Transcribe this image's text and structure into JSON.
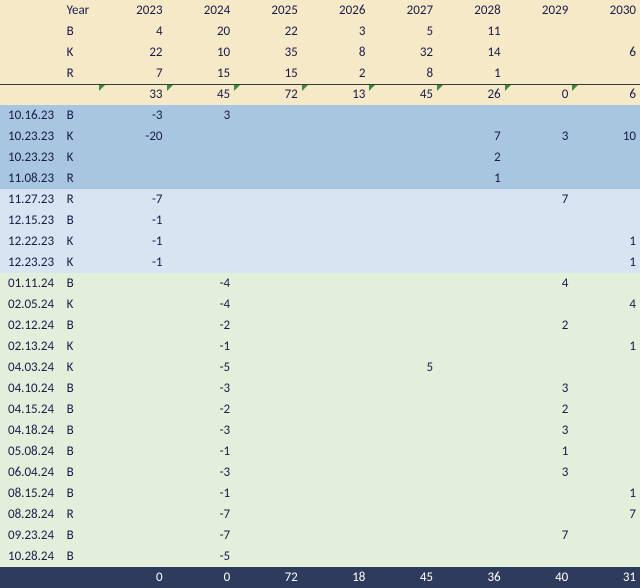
{
  "header": {
    "year_label": "Year",
    "years": [
      "2023",
      "2024",
      "2025",
      "2026",
      "2027",
      "2028",
      "2029",
      "2030"
    ],
    "series": [
      {
        "label": "B",
        "v": [
          "4",
          "20",
          "22",
          "3",
          "5",
          "11",
          "",
          ""
        ]
      },
      {
        "label": "K",
        "v": [
          "22",
          "10",
          "35",
          "8",
          "32",
          "14",
          "",
          "6"
        ]
      },
      {
        "label": "R",
        "v": [
          "7",
          "15",
          "15",
          "2",
          "8",
          "1",
          "",
          ""
        ]
      }
    ],
    "totals": [
      "33",
      "45",
      "72",
      "13",
      "45",
      "26",
      "0",
      "6"
    ]
  },
  "rows": [
    {
      "band": "blue1",
      "date": "10.16.23",
      "k": "B",
      "v": [
        "-3",
        "3",
        "",
        "",
        "",
        "",
        "",
        ""
      ]
    },
    {
      "band": "blue1",
      "date": "10.23.23",
      "k": "K",
      "v": [
        "-20",
        "",
        "",
        "",
        "",
        "7",
        "3",
        "10"
      ]
    },
    {
      "band": "blue1",
      "date": "10.23.23",
      "k": "K",
      "v": [
        "",
        "",
        "",
        "",
        "",
        "2",
        "",
        ""
      ]
    },
    {
      "band": "blue1",
      "date": "11.08.23",
      "k": "R",
      "v": [
        "",
        "",
        "",
        "",
        "",
        "1",
        "",
        ""
      ]
    },
    {
      "band": "blue2",
      "date": "11.27.23",
      "k": "R",
      "v": [
        "-7",
        "",
        "",
        "",
        "",
        "",
        "7",
        ""
      ]
    },
    {
      "band": "blue2",
      "date": "12.15.23",
      "k": "B",
      "v": [
        "-1",
        "",
        "",
        "",
        "",
        "",
        "",
        ""
      ]
    },
    {
      "band": "blue2",
      "date": "12.22.23",
      "k": "K",
      "v": [
        "-1",
        "",
        "",
        "",
        "",
        "",
        "",
        "1"
      ]
    },
    {
      "band": "blue2",
      "date": "12.23.23",
      "k": "K",
      "v": [
        "-1",
        "",
        "",
        "",
        "",
        "",
        "",
        "1"
      ]
    },
    {
      "band": "green",
      "date": "01.11.24",
      "k": "B",
      "v": [
        "",
        "-4",
        "",
        "",
        "",
        "",
        "4",
        ""
      ]
    },
    {
      "band": "green",
      "date": "02.05.24",
      "k": "K",
      "v": [
        "",
        "-4",
        "",
        "",
        "",
        "",
        "",
        "4"
      ]
    },
    {
      "band": "green",
      "date": "02.12.24",
      "k": "B",
      "v": [
        "",
        "-2",
        "",
        "",
        "",
        "",
        "2",
        ""
      ]
    },
    {
      "band": "green",
      "date": "02.13.24",
      "k": "K",
      "v": [
        "",
        "-1",
        "",
        "",
        "",
        "",
        "",
        "1"
      ]
    },
    {
      "band": "green",
      "date": "04.03.24",
      "k": "K",
      "v": [
        "",
        "-5",
        "",
        "",
        "5",
        "",
        "",
        ""
      ]
    },
    {
      "band": "green",
      "date": "04.10.24",
      "k": "B",
      "v": [
        "",
        "-3",
        "",
        "",
        "",
        "",
        "3",
        ""
      ]
    },
    {
      "band": "green",
      "date": "04.15.24",
      "k": "B",
      "v": [
        "",
        "-2",
        "",
        "",
        "",
        "",
        "2",
        ""
      ]
    },
    {
      "band": "green",
      "date": "04.18.24",
      "k": "B",
      "v": [
        "",
        "-3",
        "",
        "",
        "",
        "",
        "3",
        ""
      ]
    },
    {
      "band": "green",
      "date": "05.08.24",
      "k": "B",
      "v": [
        "",
        "-1",
        "",
        "",
        "",
        "",
        "1",
        ""
      ]
    },
    {
      "band": "green",
      "date": "06.04.24",
      "k": "B",
      "v": [
        "",
        "-3",
        "",
        "",
        "",
        "",
        "3",
        ""
      ]
    },
    {
      "band": "green",
      "date": "08.15.24",
      "k": "B",
      "v": [
        "",
        "-1",
        "",
        "",
        "",
        "",
        "",
        "1"
      ]
    },
    {
      "band": "green",
      "date": "08.28.24",
      "k": "R",
      "v": [
        "",
        "-7",
        "",
        "",
        "",
        "",
        "",
        "7"
      ]
    },
    {
      "band": "green",
      "date": "09.23.24",
      "k": "B",
      "v": [
        "",
        "-7",
        "",
        "",
        "",
        "",
        "7",
        ""
      ]
    },
    {
      "band": "green",
      "date": "10.28.24",
      "k": "B",
      "v": [
        "",
        "-5",
        "",
        "",
        "",
        "",
        "",
        ""
      ]
    }
  ],
  "footer": [
    "0",
    "0",
    "72",
    "18",
    "45",
    "36",
    "40",
    "31"
  ]
}
